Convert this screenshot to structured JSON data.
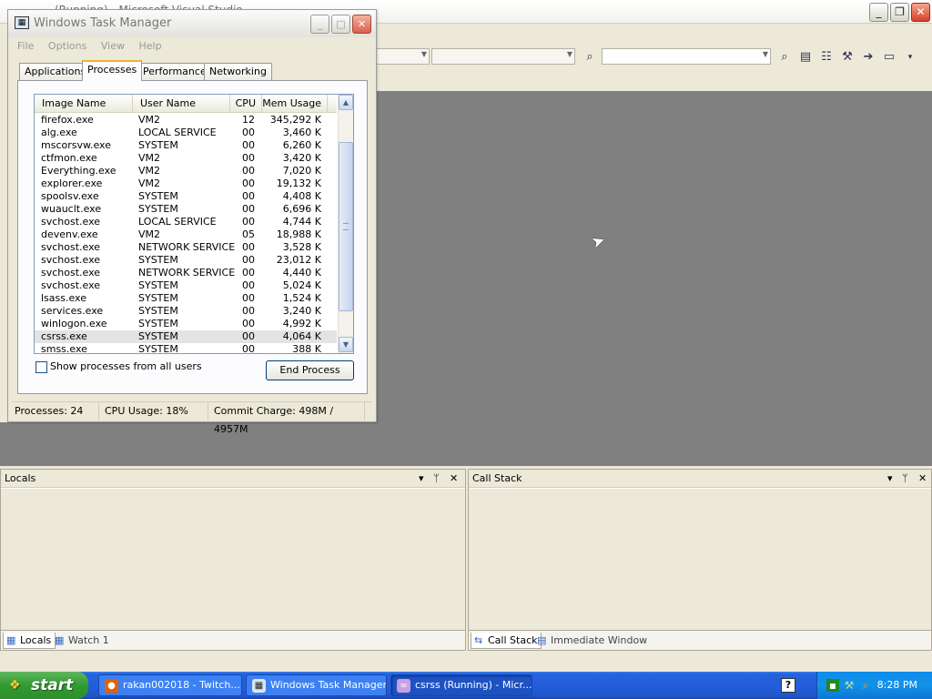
{
  "vs": {
    "title": "(Running) - Microsoft Visual Studio",
    "controls": {
      "minimize": "_",
      "restore": "❐",
      "close": "✕"
    }
  },
  "task_manager": {
    "title": "Windows Task Manager",
    "menu": [
      "File",
      "Options",
      "View",
      "Help"
    ],
    "tabs": [
      "Applications",
      "Processes",
      "Performance",
      "Networking"
    ],
    "active_tab": "Processes",
    "columns": {
      "image": "Image Name",
      "user": "User Name",
      "cpu": "CPU",
      "mem": "Mem Usage"
    },
    "processes": [
      {
        "image": "firefox.exe",
        "user": "VM2",
        "cpu": "12",
        "mem": "345,292 K"
      },
      {
        "image": "alg.exe",
        "user": "LOCAL SERVICE",
        "cpu": "00",
        "mem": "3,460 K"
      },
      {
        "image": "mscorsvw.exe",
        "user": "SYSTEM",
        "cpu": "00",
        "mem": "6,260 K"
      },
      {
        "image": "ctfmon.exe",
        "user": "VM2",
        "cpu": "00",
        "mem": "3,420 K"
      },
      {
        "image": "Everything.exe",
        "user": "VM2",
        "cpu": "00",
        "mem": "7,020 K"
      },
      {
        "image": "explorer.exe",
        "user": "VM2",
        "cpu": "00",
        "mem": "19,132 K"
      },
      {
        "image": "spoolsv.exe",
        "user": "SYSTEM",
        "cpu": "00",
        "mem": "4,408 K"
      },
      {
        "image": "wuauclt.exe",
        "user": "SYSTEM",
        "cpu": "00",
        "mem": "6,696 K"
      },
      {
        "image": "svchost.exe",
        "user": "LOCAL SERVICE",
        "cpu": "00",
        "mem": "4,744 K"
      },
      {
        "image": "devenv.exe",
        "user": "VM2",
        "cpu": "05",
        "mem": "18,988 K"
      },
      {
        "image": "svchost.exe",
        "user": "NETWORK SERVICE",
        "cpu": "00",
        "mem": "3,528 K"
      },
      {
        "image": "svchost.exe",
        "user": "SYSTEM",
        "cpu": "00",
        "mem": "23,012 K"
      },
      {
        "image": "svchost.exe",
        "user": "NETWORK SERVICE",
        "cpu": "00",
        "mem": "4,440 K"
      },
      {
        "image": "svchost.exe",
        "user": "SYSTEM",
        "cpu": "00",
        "mem": "5,024 K"
      },
      {
        "image": "lsass.exe",
        "user": "SYSTEM",
        "cpu": "00",
        "mem": "1,524 K"
      },
      {
        "image": "services.exe",
        "user": "SYSTEM",
        "cpu": "00",
        "mem": "3,240 K"
      },
      {
        "image": "winlogon.exe",
        "user": "SYSTEM",
        "cpu": "00",
        "mem": "4,992 K"
      },
      {
        "image": "csrss.exe",
        "user": "SYSTEM",
        "cpu": "00",
        "mem": "4,064 K",
        "selected": true
      },
      {
        "image": "smss.exe",
        "user": "SYSTEM",
        "cpu": "00",
        "mem": "388 K"
      }
    ],
    "show_all_label": "Show processes from all users",
    "end_process_label": "End Process",
    "status": {
      "processes": "Processes: 24",
      "cpu": "CPU Usage: 18%",
      "commit": "Commit Charge: 498M / 4957M"
    }
  },
  "panes": {
    "left": {
      "title": "Locals",
      "tabs": [
        "Locals",
        "Watch 1"
      ]
    },
    "right": {
      "title": "Call Stack",
      "tabs": [
        "Call Stack",
        "Immediate Window"
      ]
    },
    "controls": {
      "dropdown": "▾",
      "pin": "ᛘ",
      "close": "✕"
    }
  },
  "taskbar": {
    "start_label": "start",
    "tasks": [
      {
        "label": "rakan002018 - Twitch...",
        "icon": "firefox-icon",
        "active": false
      },
      {
        "label": "Windows Task Manager",
        "icon": "task-manager-icon",
        "active": false
      },
      {
        "label": "csrss (Running) - Micr...",
        "icon": "visual-studio-icon",
        "active": true
      }
    ],
    "clock": "8:28 PM"
  },
  "colors": {
    "taskbar": "#245edb",
    "start": "#319a31",
    "editor_bg": "#808080",
    "tray": "#1292e8"
  }
}
